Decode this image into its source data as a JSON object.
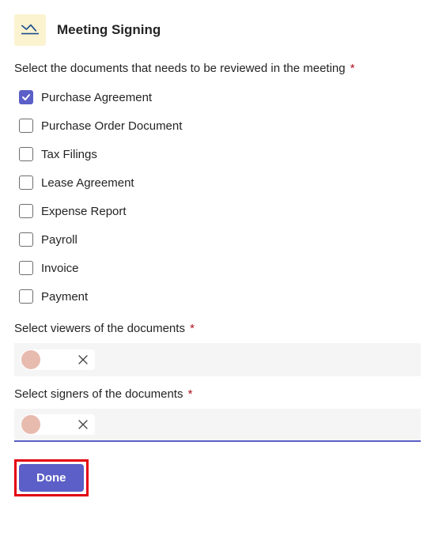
{
  "header": {
    "title": "Meeting Signing"
  },
  "documents": {
    "label": "Select the documents that needs to be reviewed in the meeting",
    "items": [
      {
        "label": "Purchase Agreement",
        "checked": true
      },
      {
        "label": "Purchase Order Document",
        "checked": false
      },
      {
        "label": "Tax Filings",
        "checked": false
      },
      {
        "label": "Lease Agreement",
        "checked": false
      },
      {
        "label": "Expense Report",
        "checked": false
      },
      {
        "label": "Payroll",
        "checked": false
      },
      {
        "label": "Invoice",
        "checked": false
      },
      {
        "label": "Payment",
        "checked": false
      }
    ]
  },
  "viewers": {
    "label": "Select viewers of the documents"
  },
  "signers": {
    "label": "Select signers of the documents"
  },
  "buttons": {
    "done": "Done"
  },
  "required_mark": "*"
}
